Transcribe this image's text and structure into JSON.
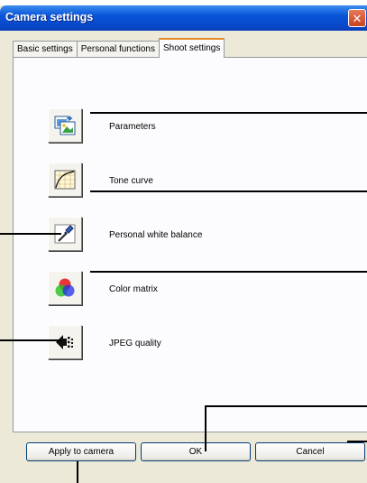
{
  "window": {
    "title": "Camera settings",
    "close_glyph": "✕"
  },
  "tabs": [
    {
      "label": "Basic settings",
      "active": false
    },
    {
      "label": "Personal functions",
      "active": false
    },
    {
      "label": "Shoot settings",
      "active": true
    }
  ],
  "items": [
    {
      "label": "Parameters",
      "icon": "parameters-icon"
    },
    {
      "label": "Tone curve",
      "icon": "tone-curve-icon"
    },
    {
      "label": "Personal white balance",
      "icon": "eyedropper-icon"
    },
    {
      "label": "Color matrix",
      "icon": "color-matrix-icon"
    },
    {
      "label": "JPEG quality",
      "icon": "jpeg-quality-icon"
    }
  ],
  "buttons": {
    "apply": "Apply to camera",
    "ok": "OK",
    "cancel": "Cancel"
  },
  "colors": {
    "titlebar": "#0a55d8",
    "dialog_bg": "#ece9d8",
    "panel_bg": "#fcfcfe",
    "active_tab_accent": "#e68b2c"
  }
}
